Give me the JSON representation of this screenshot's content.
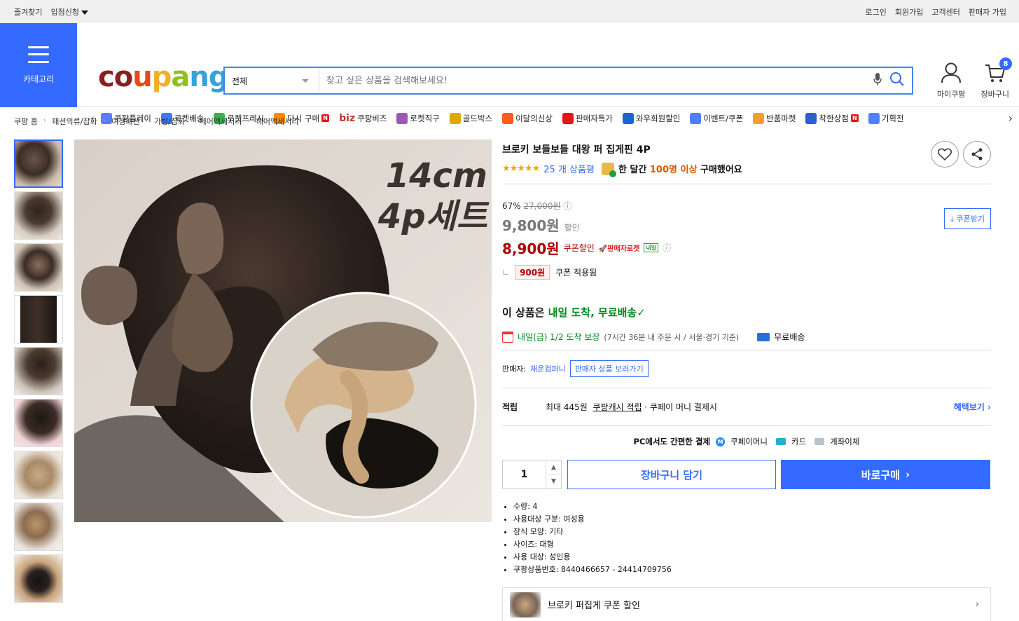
{
  "topbar": {
    "bookmark": "즐겨찾기",
    "vendor_apply": "입점신청",
    "login": "로그인",
    "signup": "회원가입",
    "customer_center": "고객센터",
    "seller_signup": "판매자 가입"
  },
  "header": {
    "category_label": "카테고리",
    "logo_letters": [
      "c",
      "o",
      "u",
      "p",
      "a",
      "n",
      "g"
    ],
    "search_scope": "전체",
    "search_placeholder": "찾고 싶은 상품을 검색해보세요!",
    "mycoupang": "마이쿠팡",
    "cart": "장바구니",
    "cart_count": "8"
  },
  "catnav": [
    {
      "label": "쿠팡플레이",
      "icon": "play-icon",
      "color": "#5b7cff"
    },
    {
      "label": "로켓배송",
      "icon": "rocket-icon",
      "color": "#3a7bff"
    },
    {
      "label": "로켓프레시",
      "icon": "rocket-fresh-icon",
      "color": "#35b24a"
    },
    {
      "label": "다시 구매",
      "icon": "rebuy-icon",
      "color": "#ff8a00",
      "badge": "N"
    },
    {
      "label": "쿠팡비즈",
      "icon": "biz-icon",
      "color": "#c0392b",
      "prefix": "biz"
    },
    {
      "label": "로켓직구",
      "icon": "global-rocket-icon",
      "color": "#9b59b6"
    },
    {
      "label": "골드박스",
      "icon": "goldbox-icon",
      "color": "#e0a800"
    },
    {
      "label": "이달의신상",
      "icon": "new-icon",
      "color": "#ff5b1a"
    },
    {
      "label": "판매자특가",
      "icon": "seller-deal-icon",
      "color": "#e3161c"
    },
    {
      "label": "와우회원할인",
      "icon": "wow-icon",
      "color": "#1e63d6"
    },
    {
      "label": "이벤트/쿠폰",
      "icon": "coupon-icon",
      "color": "#4f7fff"
    },
    {
      "label": "반품마켓",
      "icon": "return-market-icon",
      "color": "#f0a030"
    },
    {
      "label": "착한상점",
      "icon": "good-store-icon",
      "color": "#2d5fd0",
      "badge": "N"
    },
    {
      "label": "기획전",
      "icon": "tag-icon",
      "color": "#4f7fff"
    }
  ],
  "breadcrumbs": [
    "쿠팡 홈",
    "패션의류/잡화",
    "여성패션",
    "가방/잡화",
    "헤어액세서리",
    "헤어액세서리"
  ],
  "image_overlay": {
    "line1": "14cm",
    "line2": "4p세트"
  },
  "product": {
    "title": "브로키 보들보들 대왕 퍼 집게핀 4P",
    "stars": "★★★★★",
    "review_count": "25 개 상품평",
    "buy_prefix": "한 달간",
    "buy_highlight": "100명 이상",
    "buy_suffix": "구매했어요",
    "discount_rate": "67%",
    "original_price": "27,000원",
    "sale_price": "9,800원",
    "sale_label": "할인",
    "coupon_price": "8,900원",
    "coupon_label": "쿠폰할인",
    "seller_rocket": "판매자로켓",
    "nextday_badge": "내일",
    "coupon_download": "쿠폰받기",
    "coupon_amount": "900원",
    "coupon_applied": "쿠폰 적용됨",
    "delivery_prefix": "이 상품은",
    "delivery_highlight": "내일 도착, 무료배송",
    "eta": "내일(금) 1/2 도착 보장",
    "eta_sub": "(7시간 36분 내 주문 시 / 서울·경기 기준)",
    "free_shipping": "무료배송",
    "seller_label": "판매자:",
    "seller_name": "채운컴퍼니",
    "seller_more": "판매자 상품 보러가기",
    "points_label": "적립",
    "points_prefix": "최대 445원",
    "points_link": "쿠팡캐시 적립",
    "points_suffix": "· 쿠페이 머니 결제시",
    "points_more": "혜택보기",
    "pay_title": "PC에서도 간편한 결제",
    "pay_methods": [
      "쿠페이머니",
      "카드",
      "계좌이체"
    ],
    "quantity": "1",
    "add_to_cart": "장바구니 담기",
    "buy_now": "바로구매",
    "specs": [
      "수량: 4",
      "사용대상 구분: 여성용",
      "장식 모양: 기타",
      "사이즈: 대형",
      "사용 대상: 성인용",
      "쿠팡상품번호: 8440466657 - 24414709756"
    ],
    "bottom_card": "브로키 퍼집게 쿠폰 할인"
  },
  "colors": {
    "accent": "#346aff",
    "price_red": "#ae0000",
    "delivery_green": "#00891a"
  }
}
